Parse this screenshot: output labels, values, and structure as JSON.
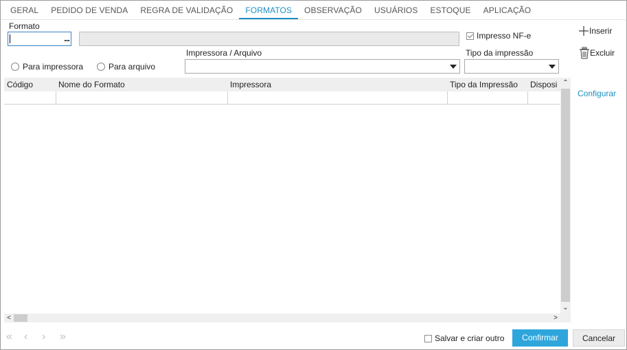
{
  "tabs": [
    {
      "label": "GERAL"
    },
    {
      "label": "PEDIDO DE VENDA"
    },
    {
      "label": "REGRA DE VALIDAÇÃO"
    },
    {
      "label": "FORMATOS"
    },
    {
      "label": "OBSERVAÇÃO"
    },
    {
      "label": "USUÁRIOS"
    },
    {
      "label": "ESTOQUE"
    },
    {
      "label": "APLICAÇÃO"
    }
  ],
  "active_tab": "FORMATOS",
  "form": {
    "formato_label": "Formato",
    "formato_value": "",
    "lookup_label": "...",
    "formato_description": "",
    "impresso_nfe_label": "Impresso NF-e",
    "impresso_nfe_checked": true,
    "radio_printer_label": "Para impressora",
    "radio_file_label": "Para arquivo",
    "printer_label": "Impressora / Arquivo",
    "printer_value": "",
    "print_type_label": "Tipo da impressão",
    "print_type_value": ""
  },
  "grid": {
    "columns": [
      "Código",
      "Nome do Formato",
      "Impressora",
      "Tipo da Impressão",
      "Disposi"
    ],
    "rows": [
      [
        "",
        "",
        "",
        "",
        ""
      ]
    ],
    "scroll_up": "⌃",
    "scroll_down": "⌄",
    "scroll_left": "<",
    "scroll_right": ">"
  },
  "side": {
    "insert_label": "Inserir",
    "delete_label": "Excluir",
    "configure_label": "Configurar"
  },
  "footer": {
    "nav_first": "«",
    "nav_prev": "‹",
    "nav_next": "›",
    "nav_last": "»",
    "save_and_create_label": "Salvar e criar outro",
    "save_and_create_checked": false,
    "confirm_label": "Confirmar",
    "cancel_label": "Cancelar"
  },
  "colors": {
    "accent": "#1a8fc4",
    "primary_button": "#2ea6dc"
  }
}
